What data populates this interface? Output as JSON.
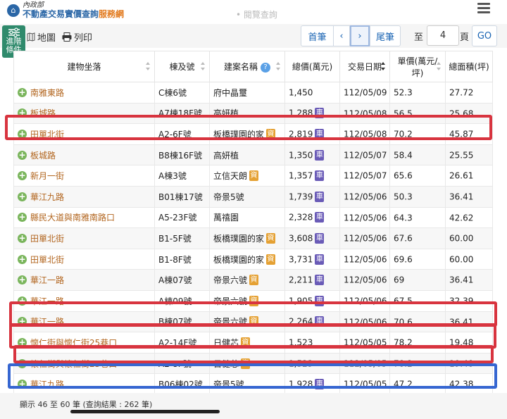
{
  "header": {
    "ministry": "內政部",
    "site_title_main": "不動產交易實價查詢",
    "site_title_accent": "服務網",
    "nav_peek": "• 閱覽查詢"
  },
  "advanced_filter": {
    "label_line1": "進階",
    "label_line2": "條件"
  },
  "toolbar": {
    "map_label": "地圖",
    "print_label": "列印",
    "first_label": "首筆",
    "prev_label": "‹",
    "next_label": "›",
    "last_label": "尾筆",
    "to_label": "至",
    "page_value": "4",
    "page_unit": "頁",
    "go_label": "GO"
  },
  "table": {
    "columns": [
      "建物坐落",
      "棟及號",
      "建案名稱",
      "總價(萬元)",
      "交易日期",
      "單價(萬元/坪)",
      "總面積(坪)"
    ],
    "rows": [
      {
        "addr": "南雅東路",
        "unit": "C棟6號",
        "project": "府中晶璽",
        "info": false,
        "price": "1,450",
        "car": false,
        "date": "112/05/09",
        "unit_price": "52.3",
        "area": "27.72"
      },
      {
        "addr": "板城路",
        "unit": "A7棟18F號",
        "project": "高妍植",
        "info": false,
        "price": "1,288",
        "car": true,
        "date": "112/05/08",
        "unit_price": "56.5",
        "area": "25.68"
      },
      {
        "addr": "田單北街",
        "unit": "A2-6F號",
        "project": "板橋璞園的家",
        "info": true,
        "price": "2,819",
        "car": true,
        "date": "112/05/08",
        "unit_price": "70.2",
        "area": "45.87"
      },
      {
        "addr": "板城路",
        "unit": "B8棟16F號",
        "project": "高妍植",
        "info": false,
        "price": "1,350",
        "car": true,
        "date": "112/05/07",
        "unit_price": "58.4",
        "area": "25.55"
      },
      {
        "addr": "新月一街",
        "unit": "A棟3號",
        "project": "立信天朗",
        "info": true,
        "price": "1,357",
        "car": true,
        "date": "112/05/07",
        "unit_price": "65.6",
        "area": "26.61"
      },
      {
        "addr": "華江九路",
        "unit": "B01棟17號",
        "project": "帝景5號",
        "info": false,
        "price": "1,739",
        "car": true,
        "date": "112/05/06",
        "unit_price": "50.3",
        "area": "36.41"
      },
      {
        "addr": "縣民大道與南雅南路口",
        "unit": "A5-23F號",
        "project": "萬禧園",
        "info": false,
        "price": "2,328",
        "car": true,
        "date": "112/05/06",
        "unit_price": "64.3",
        "area": "42.62"
      },
      {
        "addr": "田單北街",
        "unit": "B1-5F號",
        "project": "板橋璞園的家",
        "info": true,
        "price": "3,608",
        "car": true,
        "date": "112/05/06",
        "unit_price": "67.6",
        "area": "60.00"
      },
      {
        "addr": "田單北街",
        "unit": "B1-8F號",
        "project": "板橋璞園的家",
        "info": true,
        "price": "3,731",
        "car": true,
        "date": "112/05/06",
        "unit_price": "69.6",
        "area": "60.00"
      },
      {
        "addr": "華江一路",
        "unit": "A棟07號",
        "project": "帝景六號",
        "info": true,
        "price": "2,211",
        "car": true,
        "date": "112/05/06",
        "unit_price": "69",
        "area": "36.41"
      },
      {
        "addr": "華江一路",
        "unit": "A棟09號",
        "project": "帝景六號",
        "info": true,
        "price": "1,905",
        "car": true,
        "date": "112/05/06",
        "unit_price": "67.5",
        "area": "32.39"
      },
      {
        "addr": "華江一路",
        "unit": "B棟07號",
        "project": "帝景六號",
        "info": true,
        "price": "2,264",
        "car": true,
        "date": "112/05/06",
        "unit_price": "70.6",
        "area": "36.41"
      },
      {
        "addr": "懷仁街與懷仁街25巷口",
        "unit": "A2-14F號",
        "project": "日健芯",
        "info": true,
        "price": "1,523",
        "car": false,
        "date": "112/05/05",
        "unit_price": "78.2",
        "area": "19.48"
      },
      {
        "addr": "懷仁街與懷仁街25巷口",
        "unit": "A2-8F號",
        "project": "日健芯",
        "info": true,
        "price": "1,523",
        "car": false,
        "date": "112/05/05",
        "unit_price": "78.2",
        "area": "19.48"
      },
      {
        "addr": "華江九路",
        "unit": "B06棟02號",
        "project": "帝景5號",
        "info": false,
        "price": "1,928",
        "car": true,
        "date": "112/05/05",
        "unit_price": "47.2",
        "area": "42.38"
      }
    ],
    "badge_car": "車",
    "badge_info": "資"
  },
  "footer": {
    "summary": "顯示 46 至 60 筆 (查詢結果 : 262 筆)"
  },
  "colors": {
    "annotation_red": "#d8343f",
    "annotation_blue": "#3666d1",
    "link_brown": "#b2651e",
    "brand_blue": "#2a66a6"
  }
}
